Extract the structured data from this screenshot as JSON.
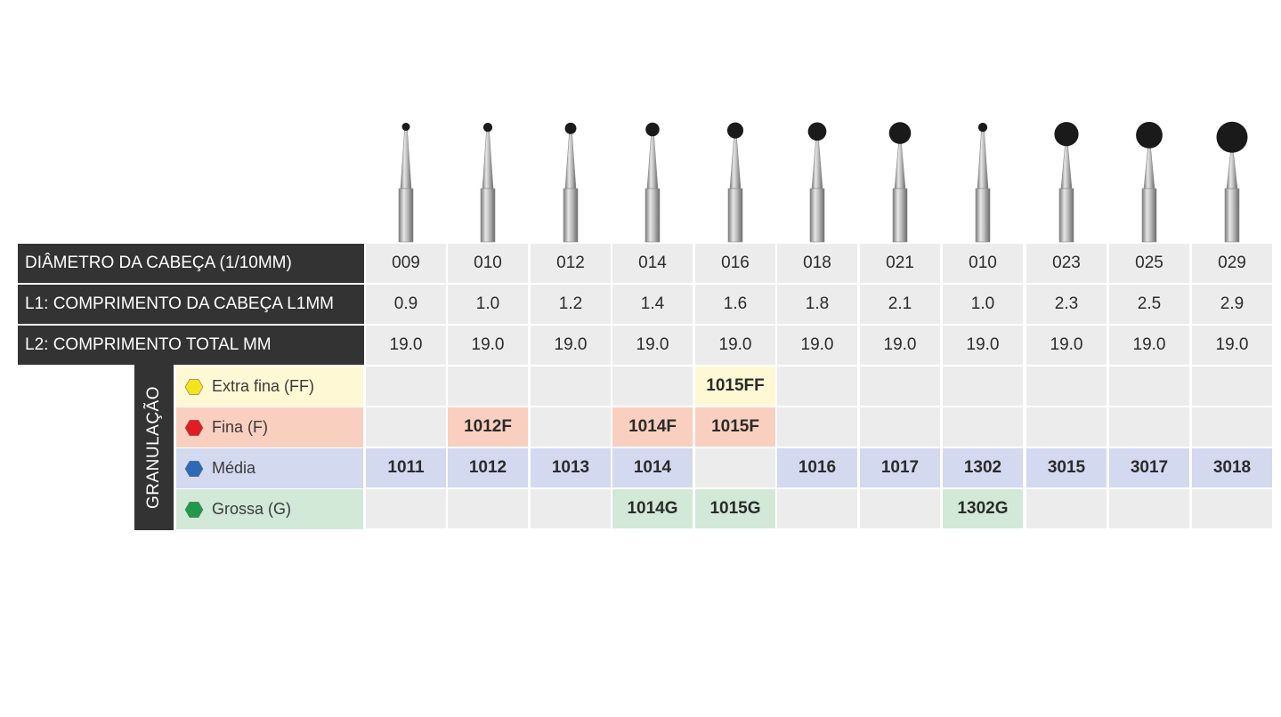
{
  "headers": {
    "diameter": "DIÂMETRO DA CABEÇA (1/10MM)",
    "head_length": "L1: COMPRIMENTO DA CABEÇA L1MM",
    "total_length": "L2: COMPRIMENTO TOTAL MM"
  },
  "granulation_label": "GRANULAÇÃO",
  "columns": [
    {
      "diameter": "009",
      "head_length": "0.9",
      "total_length": "19.0",
      "ff": "",
      "f": "",
      "m": "1011",
      "g": ""
    },
    {
      "diameter": "010",
      "head_length": "1.0",
      "total_length": "19.0",
      "ff": "",
      "f": "1012F",
      "m": "1012",
      "g": ""
    },
    {
      "diameter": "012",
      "head_length": "1.2",
      "total_length": "19.0",
      "ff": "",
      "f": "",
      "m": "1013",
      "g": ""
    },
    {
      "diameter": "014",
      "head_length": "1.4",
      "total_length": "19.0",
      "ff": "",
      "f": "1014F",
      "m": "1014",
      "g": "1014G"
    },
    {
      "diameter": "016",
      "head_length": "1.6",
      "total_length": "19.0",
      "ff": "1015FF",
      "f": "1015F",
      "m": "",
      "g": "1015G"
    },
    {
      "diameter": "018",
      "head_length": "1.8",
      "total_length": "19.0",
      "ff": "",
      "f": "",
      "m": "1016",
      "g": ""
    },
    {
      "diameter": "021",
      "head_length": "2.1",
      "total_length": "19.0",
      "ff": "",
      "f": "",
      "m": "1017",
      "g": ""
    },
    {
      "diameter": "010",
      "head_length": "1.0",
      "total_length": "19.0",
      "ff": "",
      "f": "",
      "m": "1302",
      "g": "1302G"
    },
    {
      "diameter": "023",
      "head_length": "2.3",
      "total_length": "19.0",
      "ff": "",
      "f": "",
      "m": "3015",
      "g": ""
    },
    {
      "diameter": "025",
      "head_length": "2.5",
      "total_length": "19.0",
      "ff": "",
      "f": "",
      "m": "3017",
      "g": ""
    },
    {
      "diameter": "029",
      "head_length": "2.9",
      "total_length": "19.0",
      "ff": "",
      "f": "",
      "m": "3018",
      "g": ""
    }
  ],
  "granulations": [
    {
      "key": "ff",
      "label": "Extra fina (FF)",
      "icon": "yellow-hexagon-icon",
      "color": "#f5e31a",
      "bg": "#fff8d4"
    },
    {
      "key": "f",
      "label": "Fina (F)",
      "icon": "red-hexagon-icon",
      "color": "#e31b23",
      "bg": "#f9cfbf"
    },
    {
      "key": "m",
      "label": "Média",
      "icon": "blue-hexagon-icon",
      "color": "#2a6ab8",
      "bg": "#d3d9ef"
    },
    {
      "key": "g",
      "label": "Grossa (G)",
      "icon": "green-hexagon-icon",
      "color": "#1f9a4a",
      "bg": "#d2e9d7"
    }
  ],
  "colors": {
    "header_bg": "#333333",
    "cell_bg": "#ececec",
    "bur_head": "#1a1a1a"
  }
}
